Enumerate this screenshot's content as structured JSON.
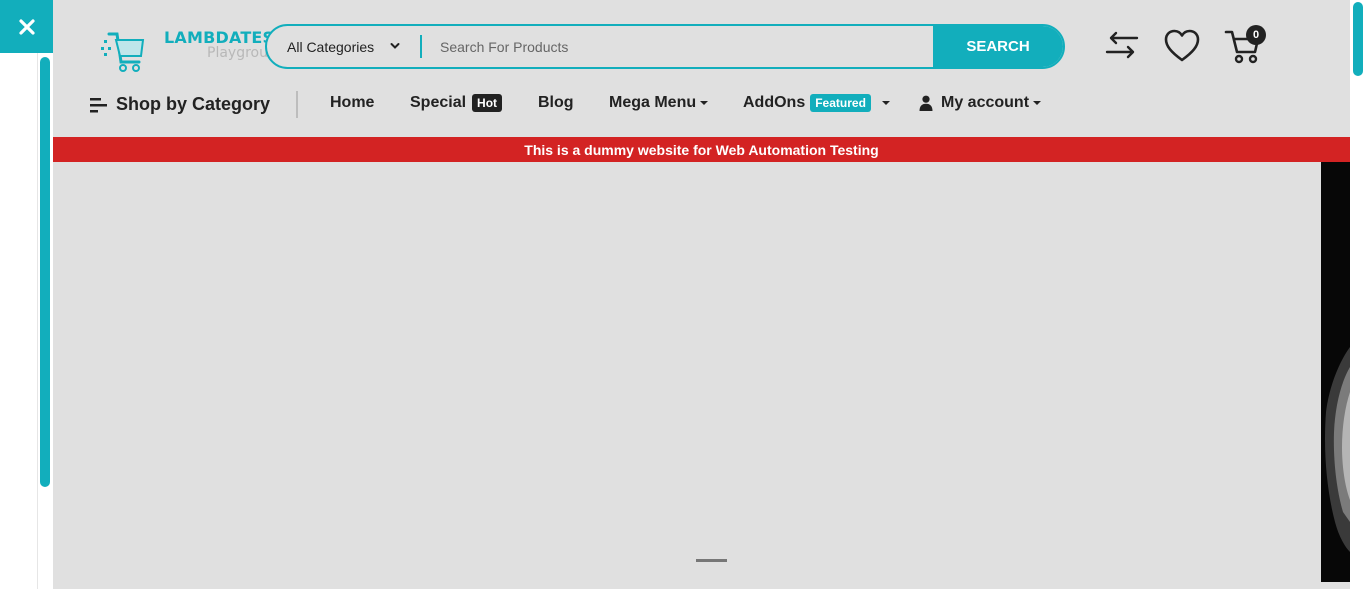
{
  "logo": {
    "line1": "LAMBDATEST",
    "line2": "Playground"
  },
  "search": {
    "category": "All Categories",
    "placeholder": "Search For Products",
    "value": "",
    "button": "SEARCH"
  },
  "header": {
    "cart_count": "0"
  },
  "nav": {
    "shop_by_category": "Shop by Category",
    "items": [
      {
        "label": "Home"
      },
      {
        "label": "Special",
        "badge": "Hot"
      },
      {
        "label": "Blog"
      },
      {
        "label": "Mega Menu"
      },
      {
        "label": "AddOns",
        "badge": "Featured"
      },
      {
        "label": "My account"
      }
    ]
  },
  "banner": {
    "text": "This is a dummy website for Web Automation Testing"
  },
  "colors": {
    "accent": "#12aebc",
    "banner": "#d32323",
    "page_bg": "#e0e0e0"
  }
}
